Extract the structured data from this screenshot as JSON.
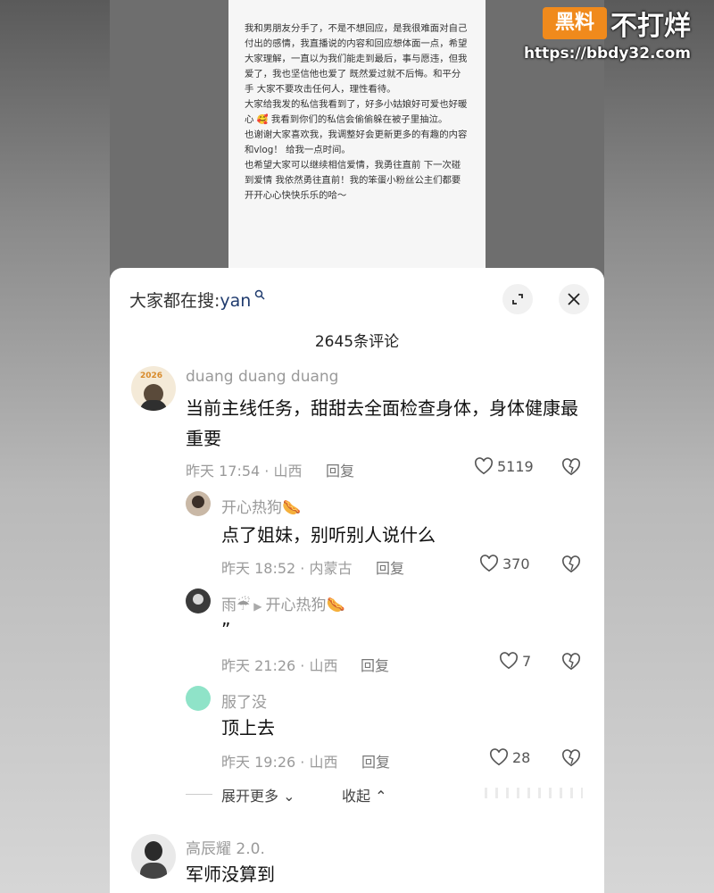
{
  "watermark": {
    "logo": "黑料",
    "title": "不打烊",
    "url": "https://bbdy32.com"
  },
  "note": {
    "paragraphs": [
      "我和男朋友分手了，不是不想回应，是我很难面对自己付出的感情，我直播说的内容和回应想体面一点，希望大家理解，一直以为我们能走到最后，事与愿违，但我爱了，我也坚信他也爱了 既然爱过就不后悔。和平分手 大家不要攻击任何人，理性看待。",
      "大家给我发的私信我看到了，好多小姑娘好可爱也好暖心 🥰 我看到你们的私信会偷偷躲在被子里抽泣。",
      "也谢谢大家喜欢我，我调整好会更新更多的有趣的内容 和vlog！ 给我一点时间。",
      "也希望大家可以继续相信爱情，我勇往直前 下一次碰到爱情 我依然勇往直前！我的笨蛋小粉丝公主们都要开开心心快快乐乐的哈～"
    ]
  },
  "sheet": {
    "search_prefix": "大家都在搜:",
    "search_term": "yan",
    "comment_count": "2645条评论",
    "expand_more": "展开更多",
    "collapse": "收起",
    "icons": {
      "search": "search-icon",
      "expand": "expand-icon",
      "close": "close-icon",
      "like": "heart-icon",
      "dislike": "dislike-icon"
    }
  },
  "comments": [
    {
      "user": "duang duang duang",
      "text": "当前主线任务，甜甜去全面检查身体，身体健康最重要",
      "meta": "昨天 17:54 · 山西",
      "reply": "回复",
      "likes": "5119",
      "avatar_badge": "2026"
    },
    {
      "user": "开心热狗🌭",
      "text": "点了姐妹，别听别人说什么",
      "meta": "昨天 18:52 · 内蒙古",
      "reply": "回复",
      "likes": "370"
    },
    {
      "user": "雨☔",
      "reply_to": "开心热狗🌭",
      "text": "”",
      "meta": "昨天 21:26 · 山西",
      "reply": "回复",
      "likes": "7"
    },
    {
      "user": "服了没",
      "text": "顶上去",
      "meta": "昨天 19:26 · 山西",
      "reply": "回复",
      "likes": "28"
    },
    {
      "user": "高辰耀 2.0.",
      "text": "军师没算到"
    }
  ]
}
